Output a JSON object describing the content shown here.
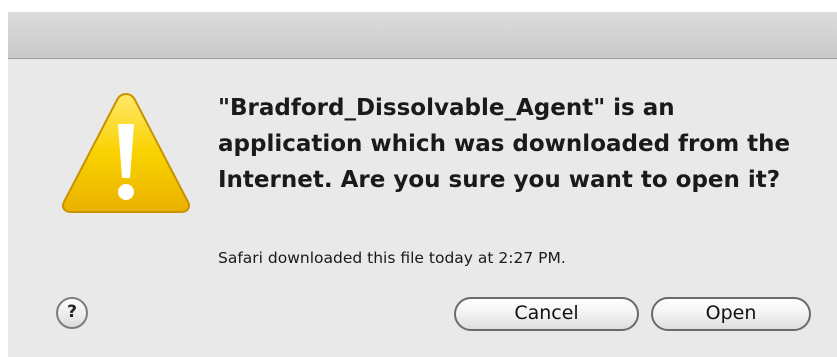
{
  "dialog": {
    "message": "\"Bradford_Dissolvable_Agent\" is an application which was downloaded from the Internet. Are you sure you want to open it?",
    "info": "Safari downloaded this file today at 2:27 PM.",
    "help_label": "?",
    "cancel_label": "Cancel",
    "open_label": "Open",
    "icon": "warning-icon"
  },
  "colors": {
    "warning_yellow": "#f6c400",
    "dialog_background": "#e9e9e9"
  }
}
